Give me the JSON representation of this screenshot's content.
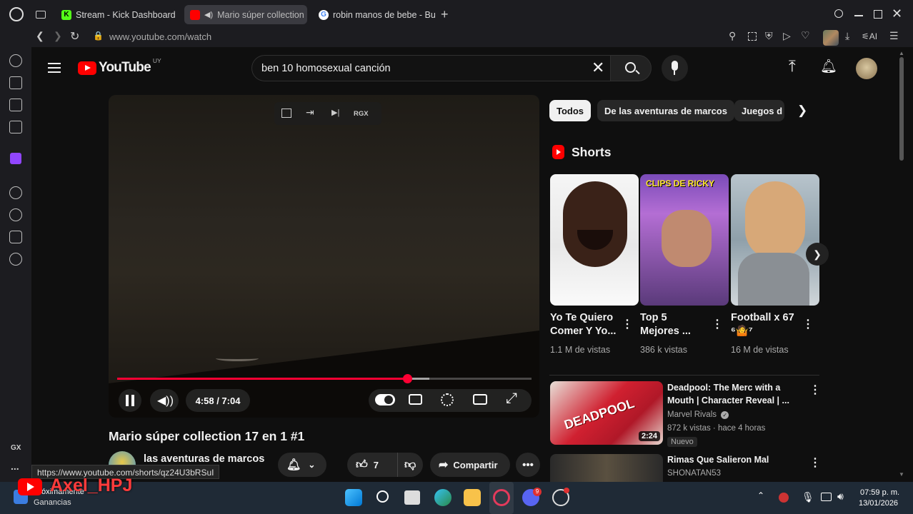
{
  "browser": {
    "tabs": [
      {
        "label": "Stream - Kick Dashboard",
        "favicon": "K"
      },
      {
        "label": "Mario súper collection",
        "favicon": "YT"
      },
      {
        "label": "robin manos de bebe - Bus",
        "favicon": "G"
      }
    ],
    "new_tab": "+",
    "url": "www.youtube.com/watch",
    "ai_label": "AI"
  },
  "sidebar": {
    "gx_label": "GX",
    "more": "..."
  },
  "youtube": {
    "logo_text": "YouTube",
    "region": "UY",
    "search_value": "ben 10 homosexual canción",
    "player": {
      "time": "4:58 / 7:04",
      "rgx_label": "RGX",
      "progress": 0.7
    },
    "video_title": "Mario súper collection 17 en 1 #1",
    "channel_name": "las aventuras de marcos",
    "like_count": "7",
    "share_label": "Compartir",
    "chips": [
      "Todos",
      "De las aventuras de marcos",
      "Juegos d"
    ],
    "shorts_heading": "Shorts",
    "shorts": [
      {
        "title": "Yo Te Quiero Comer Y Yo...",
        "views": "1.1 M de vistas"
      },
      {
        "title": "Top 5 Mejores ...",
        "views": "386 k vistas",
        "overlay": "CLIPS DE RICKY"
      },
      {
        "title": "Football x 67 ⁶🤷⁷",
        "views": "16 M de vistas"
      }
    ],
    "videos": [
      {
        "title": "Deadpool: The Merc with a Mouth | Character Reveal | ...",
        "channel": "Marvel Rivals",
        "meta": "872 k vistas · hace 4 horas",
        "badge": "Nuevo",
        "duration": "2:24",
        "thumb_text": "DEADPOOL"
      },
      {
        "title": "Rimas Que Salieron Mal",
        "channel": "SHONATAN53"
      }
    ],
    "link_preview": "https://www.youtube.com/shorts/qz24U3bRSuI"
  },
  "taskbar": {
    "widget_line1": "Próximamente",
    "widget_line2": "Ganancias",
    "watermark": "Axel_HPJ",
    "time": "07:59 p. m.",
    "date": "13/01/2026",
    "discord_badge": "9"
  },
  "colors": {
    "youtube_red": "#ff0000",
    "progress_red": "#f03",
    "bg": "#0f0f0f",
    "chip": "#272727",
    "kick_green": "#53fc18"
  }
}
